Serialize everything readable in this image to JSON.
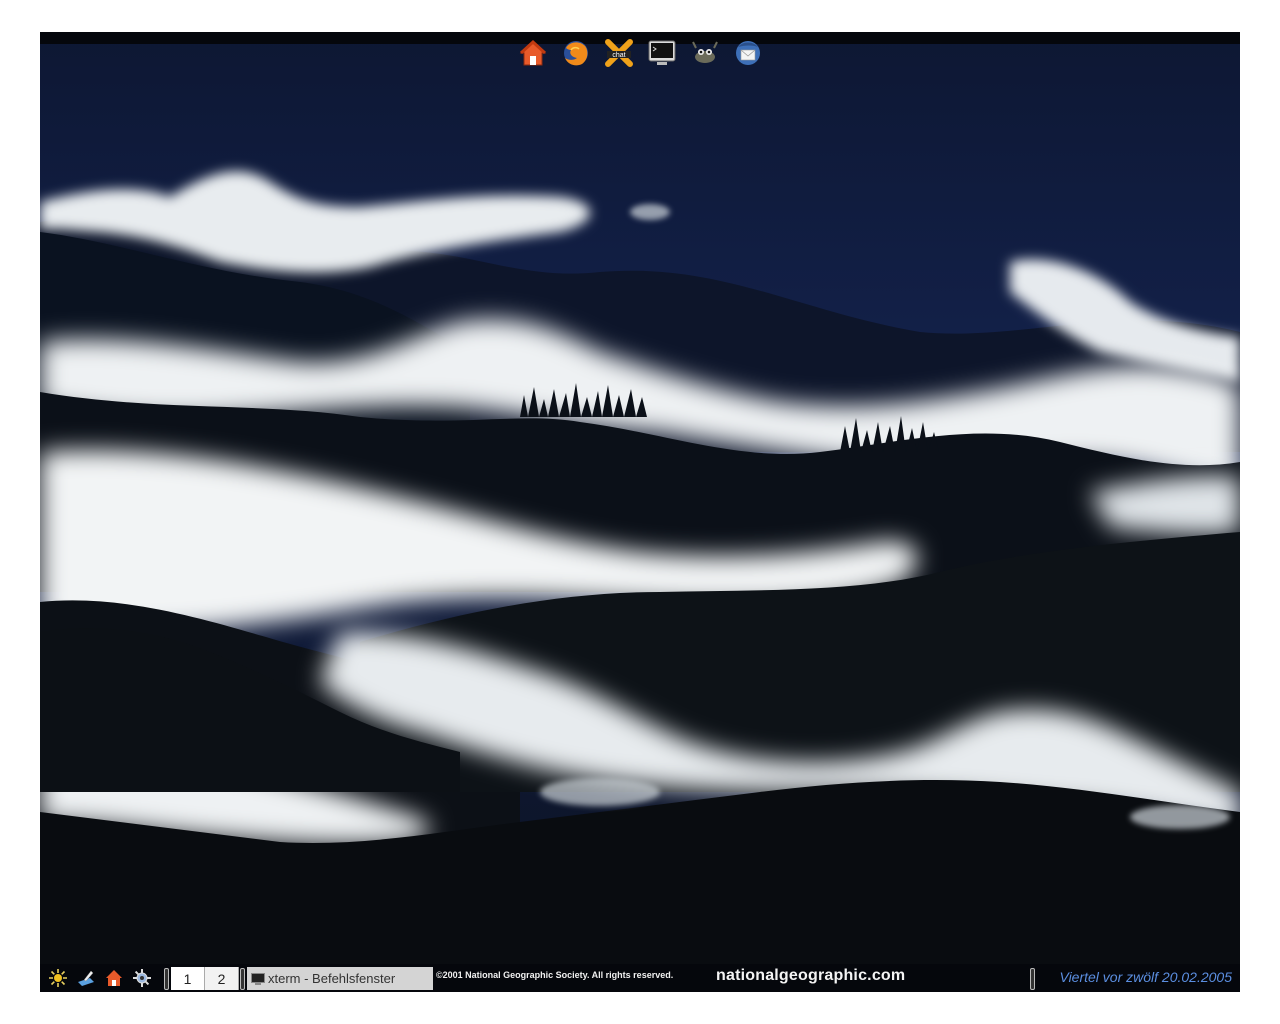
{
  "launcher": {
    "icons": [
      {
        "name": "home-icon"
      },
      {
        "name": "firefox-icon"
      },
      {
        "name": "xchat-icon",
        "label": "chat"
      },
      {
        "name": "terminal-icon"
      },
      {
        "name": "gimp-icon"
      },
      {
        "name": "thunderbird-icon"
      }
    ]
  },
  "taskbar": {
    "quick_icons": [
      "start-menu-icon",
      "editor-icon",
      "home-icon",
      "settings-icon"
    ],
    "desktops": [
      "1",
      "2"
    ],
    "active_task": "xterm - Befehlsfenster",
    "clock": "Viertel vor zwölf  20.02.2005"
  },
  "wallpaper": {
    "copyright": "©2001 National Geographic Society. All rights reserved.",
    "site": "nationalgeographic.com"
  },
  "colors": {
    "sky": "#13214a",
    "fog": "#f5f7f8",
    "forest": "#0b0f14",
    "panel": "#05070c",
    "clock": "#5b8ee0"
  }
}
